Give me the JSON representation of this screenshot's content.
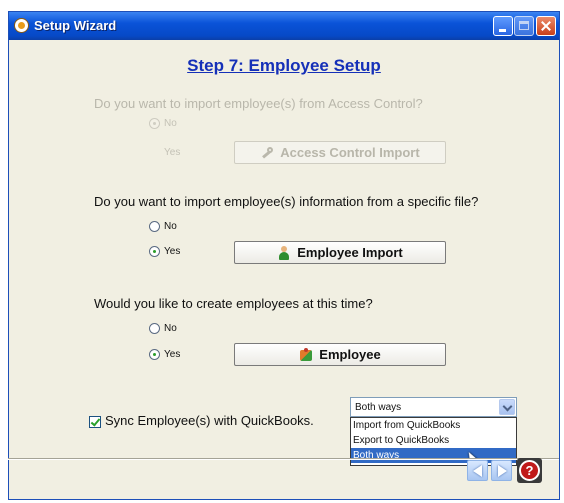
{
  "window": {
    "title": "Setup Wizard"
  },
  "step_title": "Step 7: Employee Setup",
  "sections": [
    {
      "question": "Do you want to import employee(s) from Access Control?",
      "enabled": false,
      "options": [
        {
          "label": "No",
          "checked": true
        },
        {
          "label": "Yes",
          "checked": false
        }
      ],
      "button": {
        "label": "Access Control Import",
        "icon": "key-icon"
      }
    },
    {
      "question": "Do you want to import employee(s) information from a specific file?",
      "enabled": true,
      "options": [
        {
          "label": "No",
          "checked": false
        },
        {
          "label": "Yes",
          "checked": true
        }
      ],
      "button": {
        "label": "Employee Import",
        "icon": "person-icon"
      }
    },
    {
      "question": "Would you like to create employees at this time?",
      "enabled": true,
      "options": [
        {
          "label": "No",
          "checked": false
        },
        {
          "label": "Yes",
          "checked": true
        }
      ],
      "button": {
        "label": "Employee",
        "icon": "employee-icon"
      }
    }
  ],
  "sync": {
    "label": "Sync Employee(s) with QuickBooks.",
    "checked": true,
    "selected": "Both ways",
    "options": [
      "Import from QuickBooks",
      "Export to QuickBooks",
      "Both ways"
    ],
    "highlighted_option": "Both ways"
  },
  "footer": {
    "back_icon": "back-arrow-icon",
    "next_icon": "next-arrow-icon",
    "help_icon": "help-icon",
    "help_glyph": "?"
  },
  "colors": {
    "title_bar": "#0a53d8",
    "step_title": "#1530b8",
    "dialog_bg": "#f1efe2",
    "selection": "#316ac5"
  }
}
